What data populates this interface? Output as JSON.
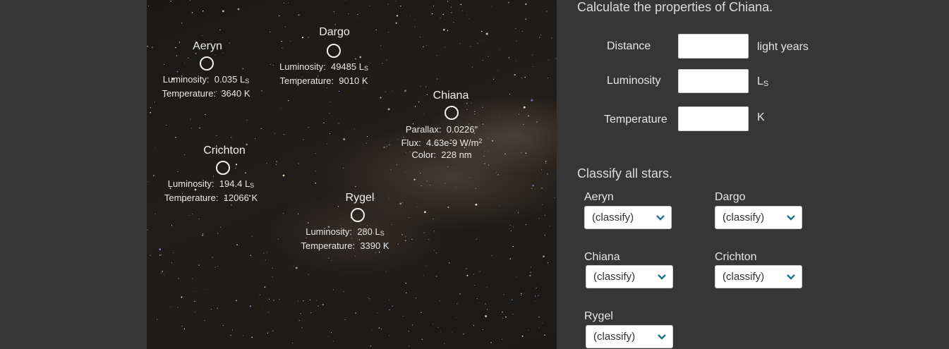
{
  "sky": {
    "stars": [
      {
        "name": "Aeryn",
        "lines": [
          {
            "label": "Luminosity:",
            "value": "0.035",
            "unit": "L",
            "unit_sub": "S"
          },
          {
            "label": "Temperature:",
            "value": "3640 K",
            "unit": "",
            "unit_sub": ""
          }
        ]
      },
      {
        "name": "Dargo",
        "lines": [
          {
            "label": "Luminosity:",
            "value": "49485",
            "unit": "L",
            "unit_sub": "S"
          },
          {
            "label": "Temperature:",
            "value": "9010 K",
            "unit": "",
            "unit_sub": ""
          }
        ]
      },
      {
        "name": "Chiana",
        "lines": [
          {
            "label": "Parallax:",
            "value": "0.0226\"",
            "unit": "",
            "unit_sub": ""
          },
          {
            "label": "Flux:",
            "value": "4.63e-9 W/m",
            "unit": "2",
            "unit_sub": ""
          },
          {
            "label": "Color:",
            "value": "228 nm",
            "unit": "",
            "unit_sub": ""
          }
        ]
      },
      {
        "name": "Crichton",
        "lines": [
          {
            "label": "Luminosity:",
            "value": "194.4",
            "unit": "L",
            "unit_sub": "S"
          },
          {
            "label": "Temperature:",
            "value": "12066 K",
            "unit": "",
            "unit_sub": ""
          }
        ]
      },
      {
        "name": "Rygel",
        "lines": [
          {
            "label": "Luminosity:",
            "value": "280",
            "unit": "L",
            "unit_sub": "S"
          },
          {
            "label": "Temperature:",
            "value": "3390 K",
            "unit": "",
            "unit_sub": ""
          }
        ]
      }
    ]
  },
  "properties": {
    "heading": "Calculate the properties of Chiana.",
    "distance": {
      "label": "Distance",
      "value": "",
      "unit": "light years"
    },
    "luminosity": {
      "label": "Luminosity",
      "value": "",
      "unit": "L",
      "unit_sub": "S"
    },
    "temperature": {
      "label": "Temperature",
      "value": "",
      "unit": "K"
    }
  },
  "classify": {
    "heading": "Classify all stars.",
    "items": [
      {
        "star": "Aeryn",
        "selected": "(classify)"
      },
      {
        "star": "Dargo",
        "selected": "(classify)"
      },
      {
        "star": "Chiana",
        "selected": "(classify)"
      },
      {
        "star": "Crichton",
        "selected": "(classify)"
      },
      {
        "star": "Rygel",
        "selected": "(classify)"
      }
    ]
  },
  "colors": {
    "accent": "#1f6f8b",
    "page_bg": "#363636"
  }
}
